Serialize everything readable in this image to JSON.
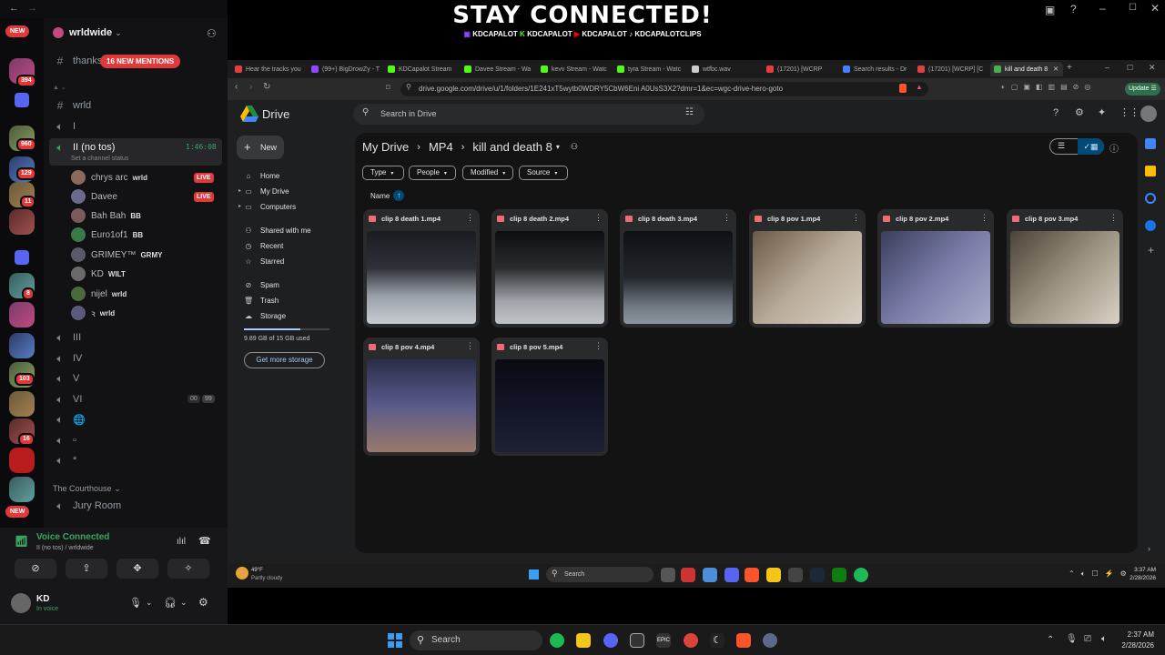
{
  "stream": {
    "headline": "STAY CONNECTED!",
    "socials": [
      "KDCAPALOT",
      "KDCAPALOT",
      "KDCAPALOT",
      "KDCAPALOTCLIPS"
    ]
  },
  "discord": {
    "server_name": "wrldwide",
    "top_channel": "thanks",
    "mentions_pill": "16 NEW MENTIONS",
    "servers_new": "NEW",
    "server_badges": [
      "394",
      "960",
      "129",
      "11",
      "8",
      "103",
      "16",
      "NEW"
    ],
    "channels": [
      {
        "name": "wrld",
        "type": "text"
      },
      {
        "name": "I",
        "type": "voice"
      },
      {
        "name": "II (no tos)",
        "type": "voice",
        "timer": "1:46:08",
        "status_hint": "Set a channel status"
      }
    ],
    "members": [
      {
        "name": "chrys arc",
        "tag": "wrld",
        "live": "LIVE"
      },
      {
        "name": "Davee",
        "tag": "",
        "live": "LIVE"
      },
      {
        "name": "Bah Bah",
        "tag": "BB",
        "live": ""
      },
      {
        "name": "Euro1of1",
        "tag": "BB",
        "live": ""
      },
      {
        "name": "GRIMEY™",
        "tag": "GRMY",
        "live": ""
      },
      {
        "name": "KD",
        "tag": "WILT",
        "live": ""
      },
      {
        "name": "nijel",
        "tag": "wrld",
        "live": ""
      },
      {
        "name": "ꝛ",
        "tag": "wrld",
        "live": ""
      }
    ],
    "more_channels": [
      "III",
      "IV",
      "V",
      "VI",
      "🌐",
      "▫",
      "*"
    ],
    "vi_counts": [
      "00",
      "99"
    ],
    "category": "The Courthouse",
    "jury": "Jury Room",
    "voice_connected": "Voice Connected",
    "voice_sub": "II (no tos) / wrldwide",
    "user": {
      "name": "KD",
      "status": "In voice"
    }
  },
  "browser": {
    "tabs": [
      {
        "label": "Hear the tracks you",
        "color": "#e04040"
      },
      {
        "label": "(99+) BigDrowZy - T",
        "color": "#9146ff"
      },
      {
        "label": "KDCapalot Stream",
        "color": "#53fc18"
      },
      {
        "label": "Davee Stream - Wa",
        "color": "#53fc18"
      },
      {
        "label": "kevv Stream - Watc",
        "color": "#53fc18"
      },
      {
        "label": "tyra Stream - Watc",
        "color": "#53fc18"
      },
      {
        "label": "wtfbc.wav",
        "color": "#cccccc"
      },
      {
        "label": "(17201) [WCRP",
        "color": "#e04040"
      },
      {
        "label": "Search results - Dr",
        "color": "#4a7cff"
      },
      {
        "label": "(17201) [WCRP] [C",
        "color": "#e04040"
      },
      {
        "label": "kill and death 8",
        "color": "#4caf50"
      }
    ],
    "url": "drive.google.com/drive/u/1/folders/1E241xT5wytb0WDRY5CbW6Eni A0UsS3X2?dmr=1&ec=wgc-drive-hero-goto",
    "update_label": "Update"
  },
  "drive": {
    "product": "Drive",
    "search_placeholder": "Search in Drive",
    "new_label": "New",
    "nav": [
      "Home",
      "My Drive",
      "Computers",
      "Shared with me",
      "Recent",
      "Starred",
      "Spam",
      "Trash",
      "Storage"
    ],
    "storage_text": "9.89 GB of 15 GB used",
    "storage_used_fraction": 0.66,
    "get_storage": "Get more storage",
    "breadcrumb": [
      "My Drive",
      "MP4",
      "kill and death 8"
    ],
    "filters": [
      "Type",
      "People",
      "Modified",
      "Source"
    ],
    "sort_label": "Name",
    "files": [
      {
        "name": "clip 8 death 1.mp4"
      },
      {
        "name": "clip 8 death 2.mp4"
      },
      {
        "name": "clip 8 death 3.mp4"
      },
      {
        "name": "clip 8 pov 1.mp4"
      },
      {
        "name": "clip 8 pov 2.mp4"
      },
      {
        "name": "clip 8 pov 3.mp4"
      },
      {
        "name": "clip 8 pov 4.mp4"
      },
      {
        "name": "clip 8 pov 5.mp4"
      }
    ]
  },
  "inner_taskbar": {
    "weather_temp": "49°F",
    "weather_desc": "Partly cloudy",
    "search": "Search",
    "time": "3:37 AM",
    "date": "2/28/2026"
  },
  "outer_taskbar": {
    "search": "Search",
    "time": "2:37 AM",
    "date": "2/28/2026"
  }
}
